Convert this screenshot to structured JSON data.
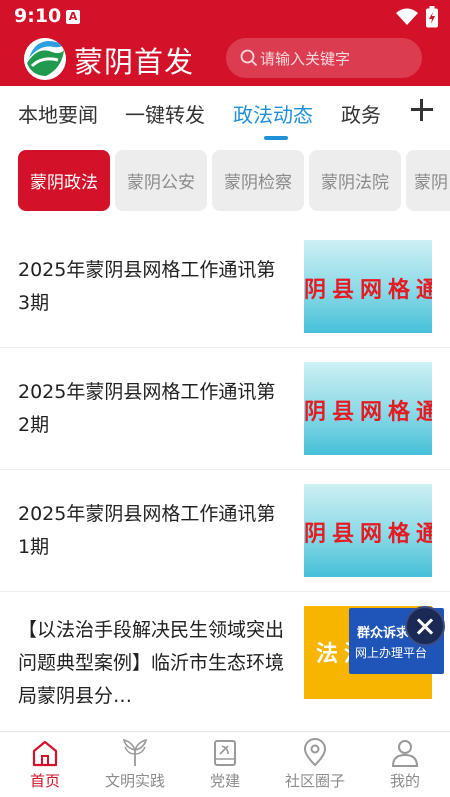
{
  "status_bar": {
    "time": "9:10",
    "notification_badge": "A"
  },
  "header": {
    "app_title": "蒙阴首发",
    "search_placeholder": "请输入关键字"
  },
  "tabs": [
    {
      "label": "本地要闻",
      "active": false
    },
    {
      "label": "一键转发",
      "active": false
    },
    {
      "label": "政法动态",
      "active": true
    },
    {
      "label": "政务",
      "active": false
    }
  ],
  "subtabs": [
    {
      "label": "蒙阴政法",
      "active": true
    },
    {
      "label": "蒙阴公安",
      "active": false
    },
    {
      "label": "蒙阴检察",
      "active": false
    },
    {
      "label": "蒙阴法院",
      "active": false
    },
    {
      "label": "蒙阴",
      "active": false
    }
  ],
  "news": [
    {
      "title": "2025年蒙阴县网格工作通讯第3期",
      "thumb_text": "阴县网格通"
    },
    {
      "title": "2025年蒙阴县网格工作通讯第2期",
      "thumb_text": "阴县网格通"
    },
    {
      "title": "2025年蒙阴县网格工作通讯第1期",
      "thumb_text": "阴县网格通"
    },
    {
      "title": "【以法治手段解决民生领域突出问题典型案例】临沂市生态环境局蒙阴县分…",
      "thumb_text": "法治"
    }
  ],
  "float_widget": {
    "line1": "群众诉求",
    "line2": "网上办理平台"
  },
  "bottom_nav": [
    {
      "label": "首页",
      "icon": "home-icon",
      "active": true
    },
    {
      "label": "文明实践",
      "icon": "civilization-icon",
      "active": false
    },
    {
      "label": "党建",
      "icon": "party-book-icon",
      "active": false
    },
    {
      "label": "社区圈子",
      "icon": "location-icon",
      "active": false
    },
    {
      "label": "我的",
      "icon": "user-icon",
      "active": false
    }
  ],
  "colors": {
    "brand_red": "#d3122a",
    "active_tab_blue": "#1e90d8",
    "widget_blue": "#1f54b8"
  }
}
